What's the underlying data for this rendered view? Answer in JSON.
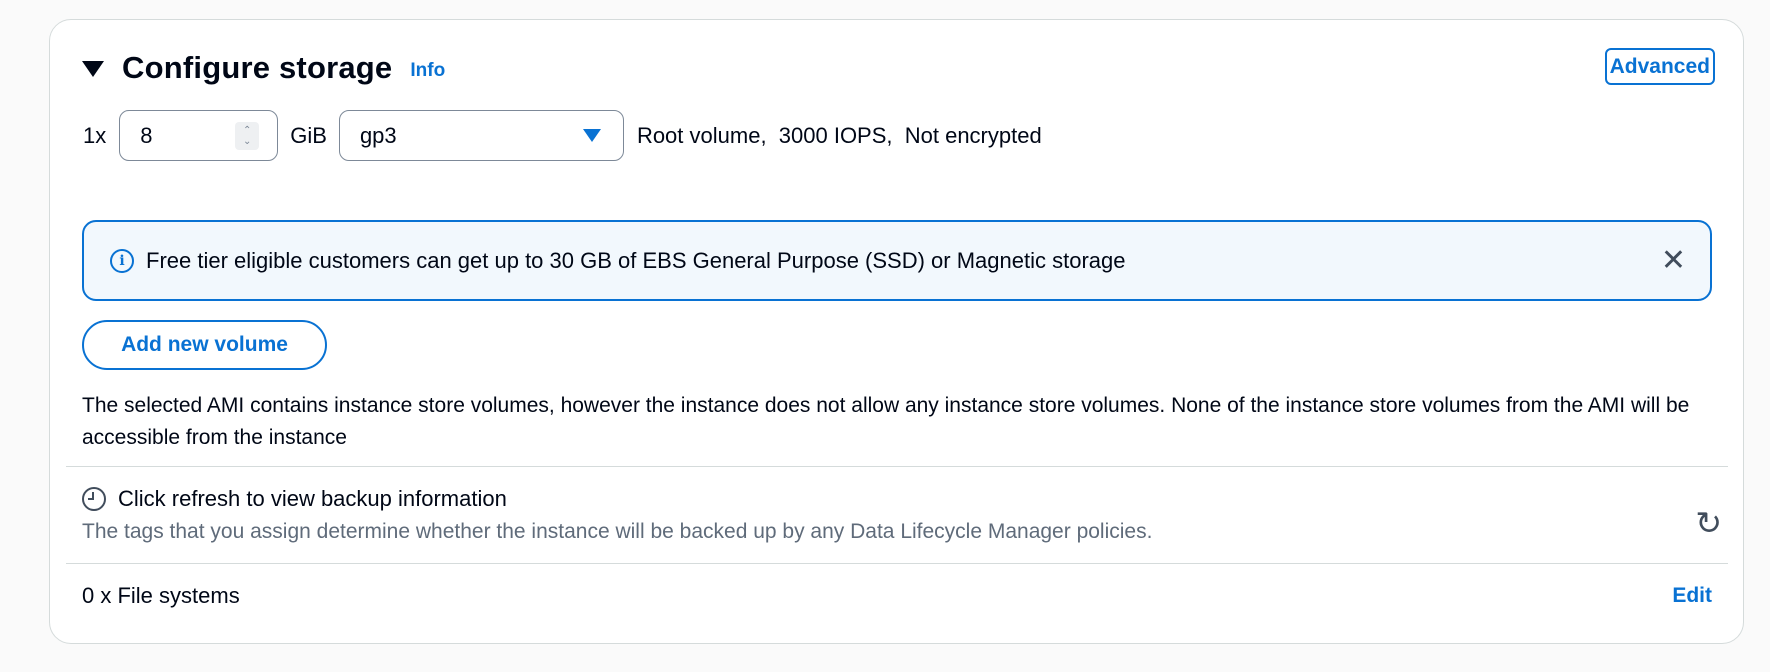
{
  "header": {
    "title": "Configure storage",
    "info_label": "Info",
    "advanced_label": "Advanced"
  },
  "volume": {
    "count_label": "1x",
    "size_value": "8",
    "unit": "GiB",
    "type_value": "gp3",
    "description": "Root volume,  3000 IOPS,  Not encrypted"
  },
  "alert": {
    "message": "Free tier eligible customers can get up to 30 GB of EBS General Purpose (SSD) or Magnetic storage"
  },
  "add_volume_label": "Add new volume",
  "ami_note": "The selected AMI contains instance store volumes, however the instance does not allow any instance store volumes. None of the instance store volumes from the AMI will be accessible from the instance",
  "backup": {
    "title": "Click refresh to view backup information",
    "subtitle": "The tags that you assign determine whether the instance will be backed up by any Data Lifecycle Manager policies."
  },
  "file_systems": {
    "label": "0 x File systems",
    "edit_label": "Edit"
  },
  "colors": {
    "accent": "#0972d3",
    "alert_bg": "#f2f8fd",
    "text": "#000716",
    "muted": "#5f6b7a"
  }
}
